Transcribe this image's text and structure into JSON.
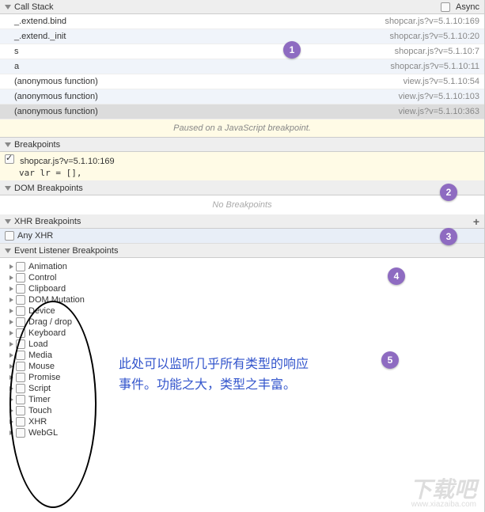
{
  "callStack": {
    "title": "Call Stack",
    "asyncLabel": "Async",
    "frames": [
      {
        "fn": "_.extend.bind",
        "loc": "shopcar.js?v=5.1.10:169",
        "alt": false
      },
      {
        "fn": "_.extend._init",
        "loc": "shopcar.js?v=5.1.10:20",
        "alt": true
      },
      {
        "fn": "s",
        "loc": "shopcar.js?v=5.1.10:7",
        "alt": false
      },
      {
        "fn": "a",
        "loc": "shopcar.js?v=5.1.10:11",
        "alt": true
      },
      {
        "fn": "(anonymous function)",
        "loc": "view.js?v=5.1.10:54",
        "alt": false
      },
      {
        "fn": "(anonymous function)",
        "loc": "view.js?v=5.1.10:103",
        "alt": true
      },
      {
        "fn": "(anonymous function)",
        "loc": "view.js?v=5.1.10:363",
        "alt": false,
        "sel": true
      }
    ],
    "pauseMsg": "Paused on a JavaScript breakpoint."
  },
  "breakpoints": {
    "title": "Breakpoints",
    "items": [
      {
        "label": "shopcar.js?v=5.1.10:169",
        "code": "var lr = [],"
      }
    ]
  },
  "domBp": {
    "title": "DOM Breakpoints",
    "empty": "No Breakpoints"
  },
  "xhrBp": {
    "title": "XHR Breakpoints",
    "anyLabel": "Any XHR"
  },
  "eventBp": {
    "title": "Event Listener Breakpoints",
    "cats": [
      "Animation",
      "Control",
      "Clipboard",
      "DOM Mutation",
      "Device",
      "Drag / drop",
      "Keyboard",
      "Load",
      "Media",
      "Mouse",
      "Promise",
      "Script",
      "Timer",
      "Touch",
      "XHR",
      "WebGL"
    ]
  },
  "badges": {
    "b1": "1",
    "b2": "2",
    "b3": "3",
    "b4": "4",
    "b5": "5"
  },
  "annotation": "此处可以监听几乎所有类型的响应事件。功能之大，类型之丰富。",
  "watermark": "下载吧",
  "watermarkUrl": "www.xiazaiba.com"
}
